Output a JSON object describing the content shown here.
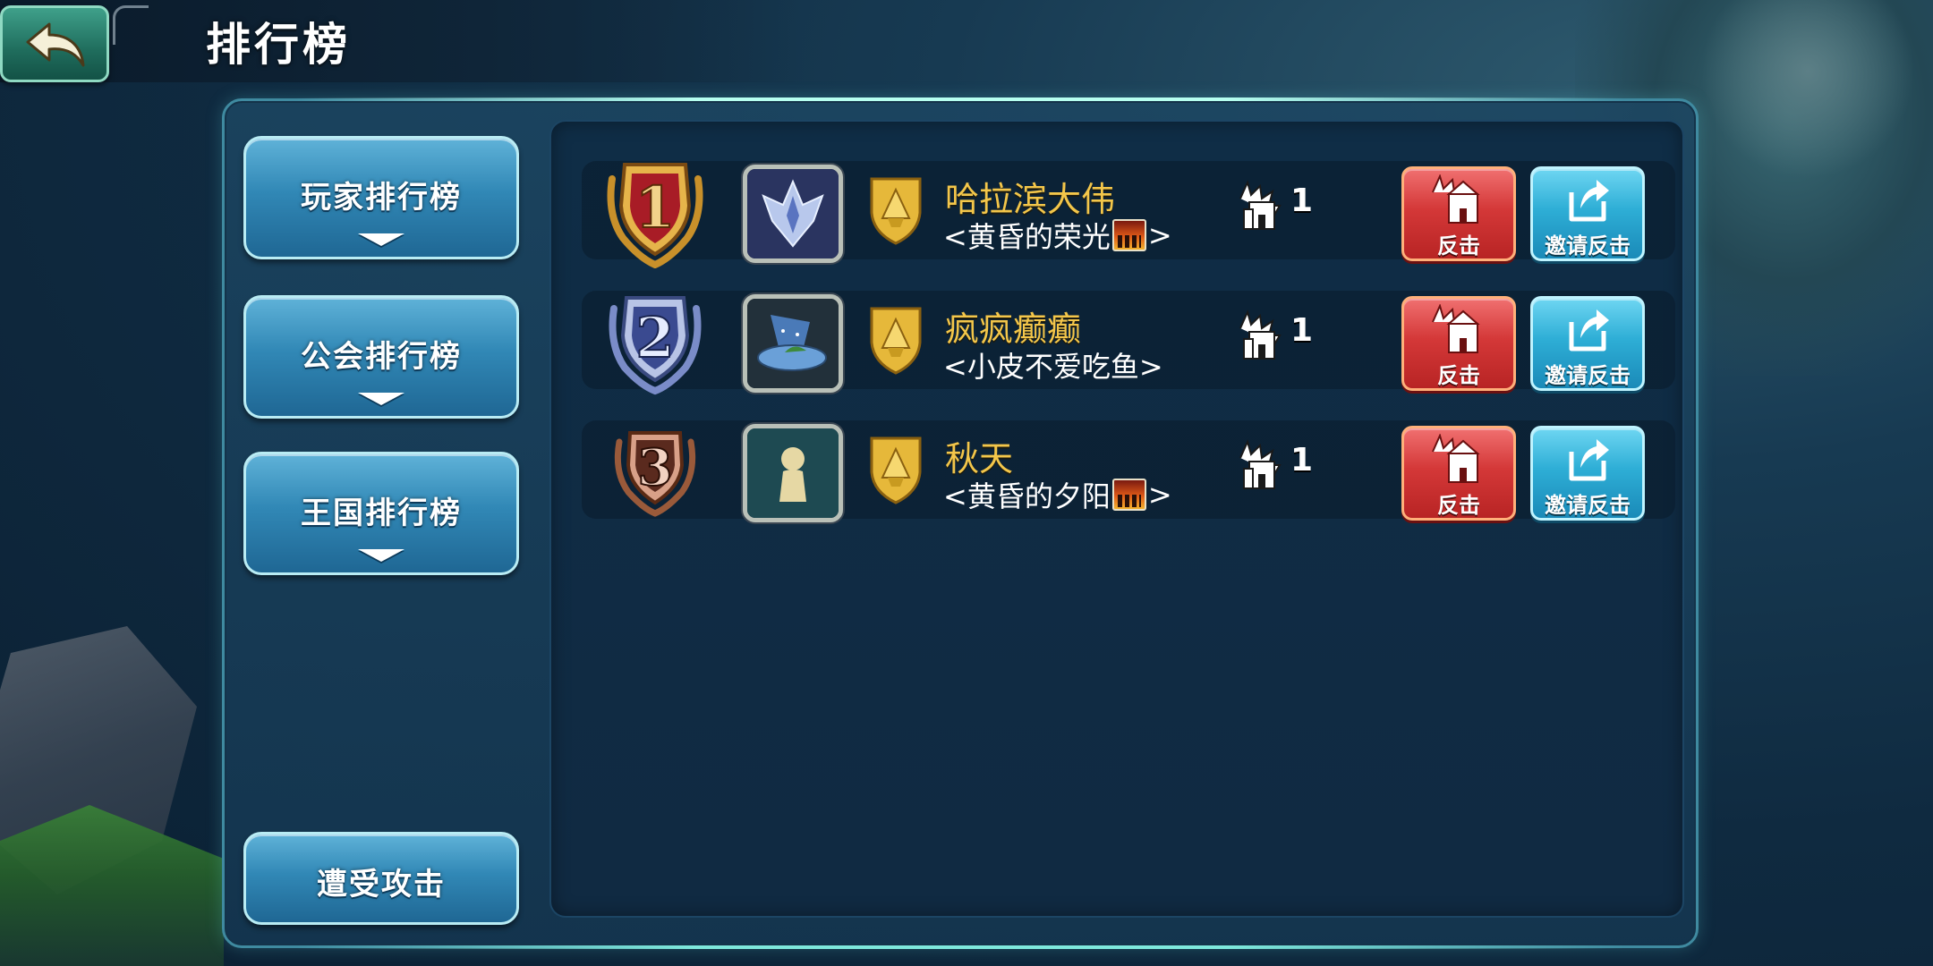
{
  "header": {
    "title": "排行榜",
    "back_icon": "back-arrow-icon"
  },
  "sidebar": {
    "tabs": [
      {
        "label": "玩家排行榜"
      },
      {
        "label": "公会排行榜"
      },
      {
        "label": "王国排行榜"
      }
    ],
    "attack_label": "遭受攻击"
  },
  "rankings": [
    {
      "rank": "1",
      "rank_color": "#b0202a",
      "name": "哈拉滨大伟",
      "guild_prefix": "<黄昏的荣光",
      "guild_suffix": ">",
      "guild_has_flag": true,
      "castle_count": "1",
      "counter_label": "反击",
      "invite_label": "邀请反击",
      "avatar_icon": "winged-emblem-icon"
    },
    {
      "rank": "2",
      "rank_color": "#3a4a90",
      "name": "疯疯癫癫",
      "guild_prefix": "<小皮不爱吃鱼>",
      "guild_suffix": "",
      "guild_has_flag": false,
      "castle_count": "1",
      "counter_label": "反击",
      "invite_label": "邀请反击",
      "avatar_icon": "wizard-hat-icon"
    },
    {
      "rank": "3",
      "rank_color": "#5a2a1e",
      "name": "秋天",
      "guild_prefix": "<黄昏的夕阳",
      "guild_suffix": ">",
      "guild_has_flag": true,
      "castle_count": "1",
      "counter_label": "反击",
      "invite_label": "邀请反击",
      "avatar_icon": "default-player-icon"
    }
  ],
  "colors": {
    "name_gold": "#f3c64a",
    "counter_red": "#d43838",
    "invite_blue": "#2eaed6",
    "tab_blue": "#3188b6"
  }
}
